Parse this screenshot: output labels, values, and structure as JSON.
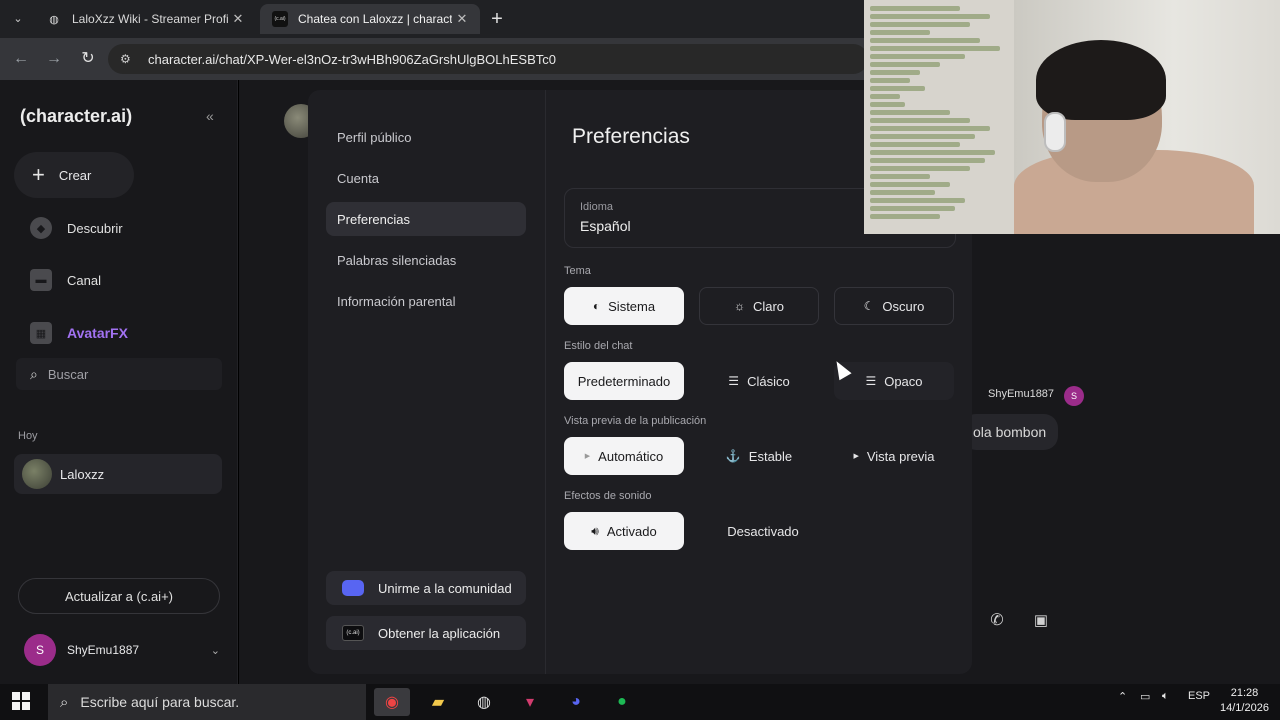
{
  "browser": {
    "tabs": [
      {
        "title": "LaloXzz Wiki - Streamer Profil | ",
        "active": false
      },
      {
        "title": "Chatea con Laloxzz | character.ai",
        "active": true
      }
    ],
    "tab2_favicon": "(c.ai)",
    "url": "character.ai/chat/XP-Wer-el3nOz-tr3wHBh906ZaGrshUlgBOLhESBTc0"
  },
  "sidebar": {
    "brand": "(character.ai)",
    "create_label": "Crear",
    "items": [
      {
        "label": "Descubrir",
        "icon": "compass-icon"
      },
      {
        "label": "Canal",
        "icon": "channel-icon"
      },
      {
        "label": "AvatarFX",
        "icon": "film-icon"
      }
    ],
    "search_placeholder": "Buscar",
    "section_today": "Hoy",
    "recent_chat": "Laloxzz",
    "upgrade_label": "Actualizar a (c.ai+)",
    "user": {
      "initial": "S",
      "name": "ShyEmu1887"
    }
  },
  "chat": {
    "message_author": "ShyEmu1887",
    "message_author_initial": "S",
    "message_text": "ola bombon"
  },
  "modal": {
    "nav": [
      {
        "label": "Perfil público",
        "active": false
      },
      {
        "label": "Cuenta",
        "active": false
      },
      {
        "label": "Preferencias",
        "active": true
      },
      {
        "label": "Palabras silenciadas",
        "active": false
      },
      {
        "label": "Información parental",
        "active": false
      }
    ],
    "community_label": "Unirme a la comunidad",
    "getapp_label": "Obtener la aplicación",
    "getapp_icon_text": "(c.ai)",
    "title": "Preferencias",
    "language": {
      "label": "Idioma",
      "value": "Español"
    },
    "theme": {
      "label": "Tema",
      "options": [
        {
          "label": "Sistema",
          "selected": true
        },
        {
          "label": "Claro",
          "selected": false
        },
        {
          "label": "Oscuro",
          "selected": false
        }
      ]
    },
    "chat_style": {
      "label": "Estilo del chat",
      "options": [
        {
          "label": "Predeterminado",
          "selected": true
        },
        {
          "label": "Clásico",
          "selected": false
        },
        {
          "label": "Opaco",
          "selected": false
        }
      ]
    },
    "post_preview": {
      "label": "Vista previa de la publicación",
      "options": [
        {
          "label": "Automático",
          "selected": true
        },
        {
          "label": "Estable",
          "selected": false
        },
        {
          "label": "Vista previa",
          "selected": false
        }
      ]
    },
    "sound_effects": {
      "label": "Efectos de sonido",
      "options": [
        {
          "label": "Activado",
          "selected": true
        },
        {
          "label": "Desactivado",
          "selected": false
        }
      ]
    }
  },
  "taskbar": {
    "search_placeholder": "Escribe aquí para buscar.",
    "language": "ESP",
    "time": "21:28",
    "date": "14/1/2026"
  },
  "colors": {
    "accent_purple": "#a272f2",
    "user_avatar": "#9b2c8a",
    "discord": "#5865f2"
  }
}
